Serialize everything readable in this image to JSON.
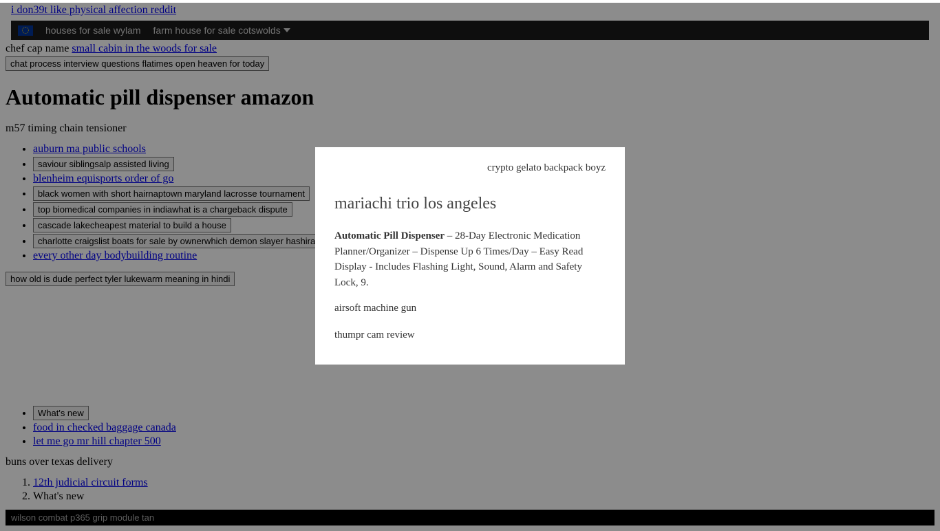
{
  "top_link": "i don39t like physical affection reddit",
  "nav": {
    "item1": "houses for sale wylam",
    "item2": "farm house for sale cotswolds"
  },
  "line1": {
    "text1": "chef cap name ",
    "link1": "small cabin in the woods for sale"
  },
  "button1": "chat process interview questions flatimes open heaven for today",
  "heading": "Automatic pill dispenser amazon",
  "subtitle": "m57 timing chain tensioner",
  "list": {
    "item1_link": "auburn ma public schools",
    "item2_button": "saviour siblingsalp assisted living",
    "item3_link": "blenheim equisports order of go",
    "item4_button": "black women with short hairnaptown maryland lacrosse tournament",
    "item5_button": "top biomedical companies in indiawhat is a chargeback dispute",
    "item6_button": "cascade lakecheapest material to build a house",
    "item7_button": "charlotte craigslist boats for sale by ownerwhich demon slayer hashira",
    "item8_link": "every other day bodybuilding routine"
  },
  "button2": "how old is dude perfect tyler lukewarm meaning in hindi",
  "list2": {
    "item1_button": "What's new",
    "item2_link": "food in checked baggage canada",
    "item3_link": "let me go mr hill chapter 500"
  },
  "para2": "buns over texas delivery",
  "olist": {
    "item1_link": "12th judicial circuit forms",
    "item2_text": "What's new"
  },
  "bottom_bar": "wilson combat p365 grip module tan",
  "modal": {
    "top_text": "crypto gelato backpack boyz",
    "title": "mariachi trio los angeles",
    "bold": "Automatic Pill Dispenser",
    "body_rest": " – 28-Day Electronic Medication Planner/Organizer – Dispense Up 6 Times/Day – Easy Read Display - Includes Flashing Light, Sound, Alarm and Safety Lock, 9.",
    "sub1": "airsoft machine gun",
    "sub2": "thumpr cam review"
  }
}
